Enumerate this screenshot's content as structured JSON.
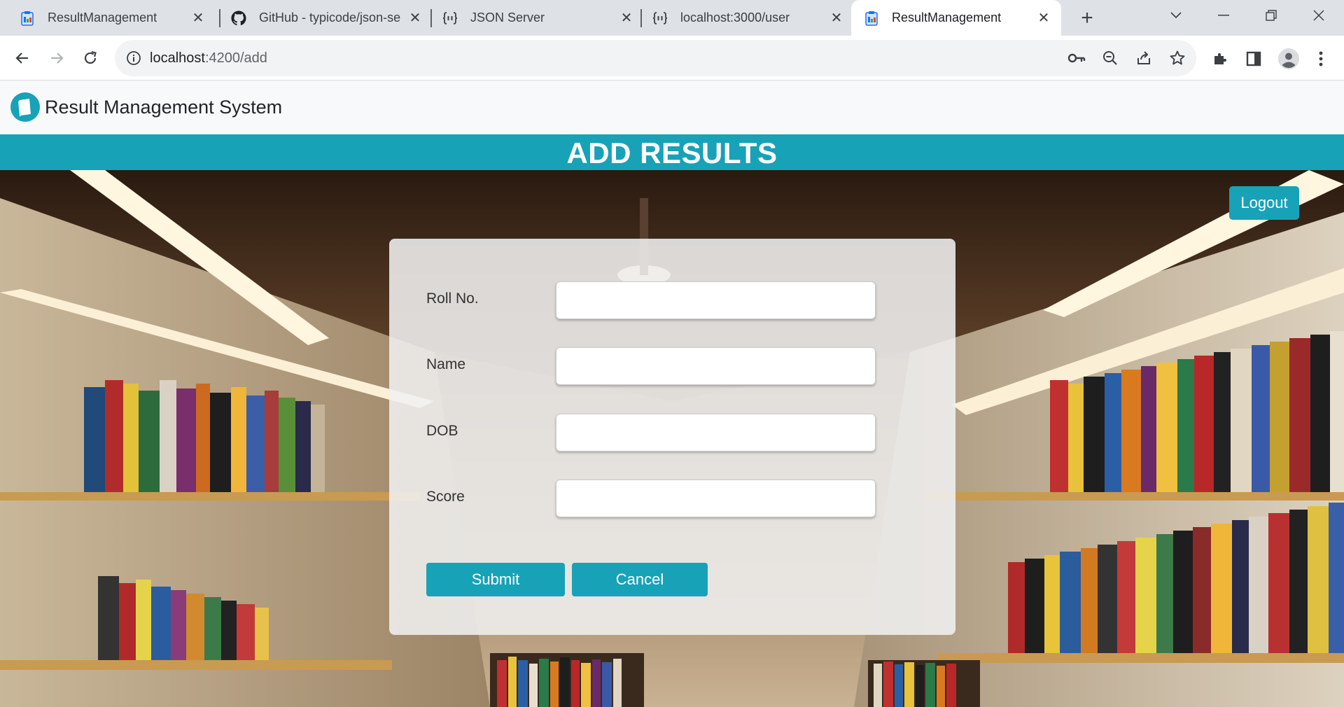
{
  "browser": {
    "tabs": [
      {
        "title": "ResultManagement",
        "icon": "clipboard-icon"
      },
      {
        "title": "GitHub - typicode/json-se",
        "icon": "github-icon"
      },
      {
        "title": "JSON Server",
        "icon": "json-server-icon"
      },
      {
        "title": "localhost:3000/user",
        "icon": "json-server-icon"
      },
      {
        "title": "ResultManagement",
        "icon": "clipboard-icon",
        "active": true
      }
    ],
    "url_host": "localhost",
    "url_rest": ":4200/add"
  },
  "app": {
    "brand": "Result Management System",
    "banner": "ADD RESULTS",
    "logout_label": "Logout",
    "accent_color": "#17a2b8"
  },
  "form": {
    "fields": [
      {
        "label": "Roll No.",
        "value": ""
      },
      {
        "label": "Name",
        "value": ""
      },
      {
        "label": "DOB",
        "value": ""
      },
      {
        "label": "Score",
        "value": ""
      }
    ],
    "submit_label": "Submit",
    "cancel_label": "Cancel"
  }
}
